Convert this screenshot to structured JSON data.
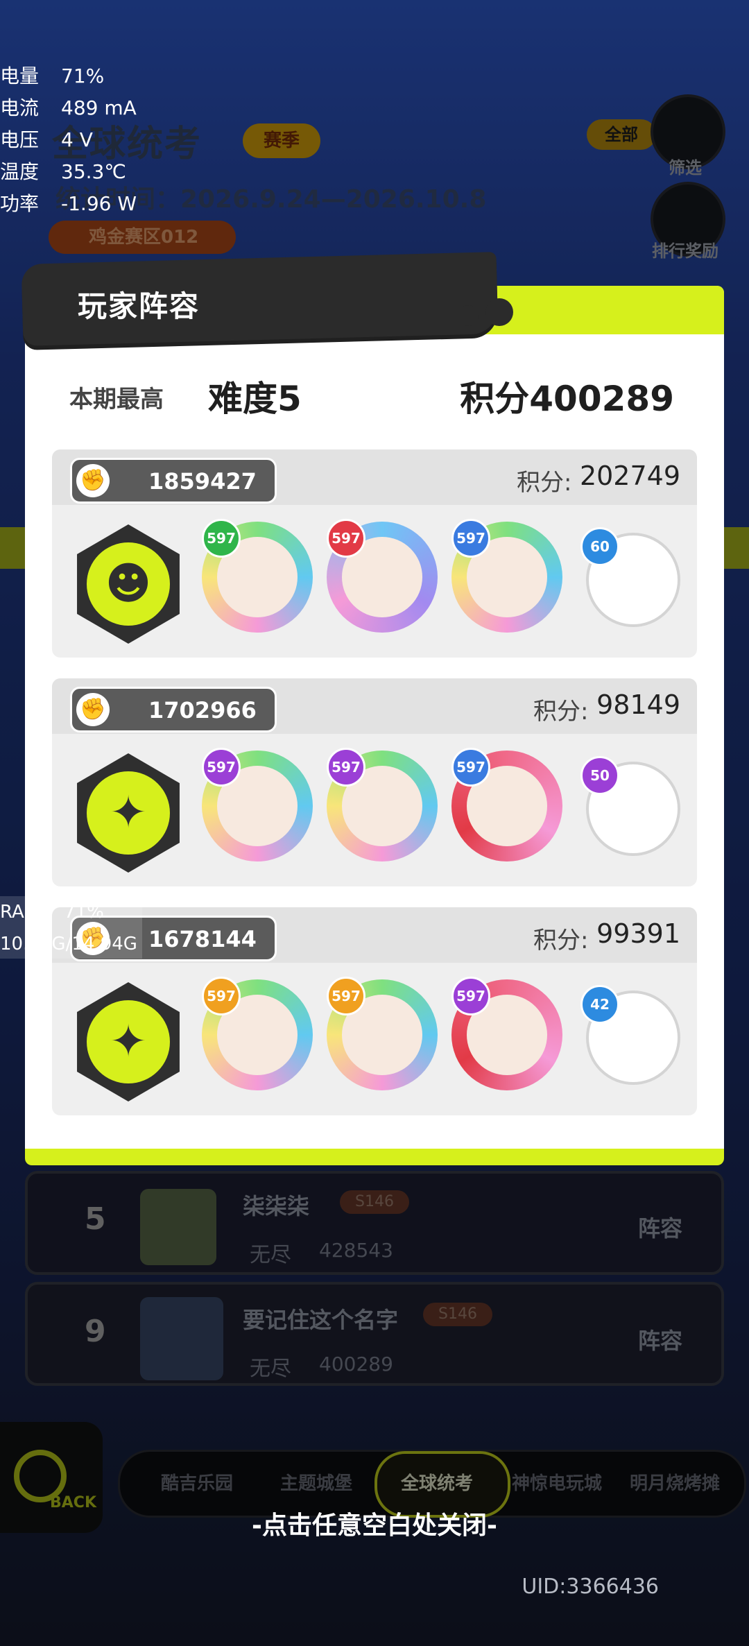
{
  "status_overlay": {
    "rows": [
      {
        "label": "电量",
        "value": "71%"
      },
      {
        "label": "电流",
        "value": "489 mA"
      },
      {
        "label": "电压",
        "value": "4 V"
      },
      {
        "label": "温度",
        "value": "35.3℃"
      },
      {
        "label": "功率",
        "value": "-1.96 W"
      }
    ],
    "ram_label": "RAM",
    "ram_percent": "71%",
    "ram_usage": "10.69G/14.94G"
  },
  "background": {
    "title": "全球统考",
    "season_badge": "赛季",
    "stat_time": "统计时间：2026.9.24—2026.10.8",
    "zone": "鸡金赛区012",
    "filter_all": "全部",
    "filter_label": "筛选",
    "reward_label": "排行奖励"
  },
  "modal": {
    "title": "玩家阵容",
    "best_label": "本期最高",
    "best_difficulty": "难度5",
    "best_score": "积分400289",
    "score_label": "积分:",
    "teams": [
      {
        "id": "1859427",
        "score": "202749",
        "heroes": [
          {
            "lv": "597",
            "color": "#2fb54a"
          },
          {
            "lv": "597",
            "color": "#e23a46"
          },
          {
            "lv": "597",
            "color": "#3a7be0"
          }
        ],
        "pet_lv": "60"
      },
      {
        "id": "1702966",
        "score": "98149",
        "heroes": [
          {
            "lv": "597",
            "color": "#9b3fd6"
          },
          {
            "lv": "597",
            "color": "#9b3fd6"
          },
          {
            "lv": "597",
            "color": "#3a7be0"
          }
        ],
        "pet_lv": "50"
      },
      {
        "id": "1678144",
        "score": "99391",
        "heroes": [
          {
            "lv": "597",
            "color": "#f0a020"
          },
          {
            "lv": "597",
            "color": "#f0a020"
          },
          {
            "lv": "597",
            "color": "#9b3fd6"
          }
        ],
        "pet_lv": "42"
      }
    ]
  },
  "ranking_rows": [
    {
      "rank": "5",
      "name": "柒柒柒",
      "season": "S146",
      "mode": "无尽",
      "score": "428543",
      "lineup": "阵容"
    },
    {
      "rank": "9",
      "name": "要记住这个名字",
      "season": "S146",
      "mode": "无尽",
      "score": "400289",
      "lineup": "阵容"
    }
  ],
  "tabs": [
    "酷吉乐园",
    "主题城堡",
    "全球统考",
    "神惊电玩城",
    "明月烧烤摊"
  ],
  "back_label": "BACK",
  "close_tip": "-点击任意空白处关闭-",
  "uid": "UID:3366436",
  "colors": {
    "accent": "#d6f01c",
    "dark": "#2b2b2b"
  }
}
